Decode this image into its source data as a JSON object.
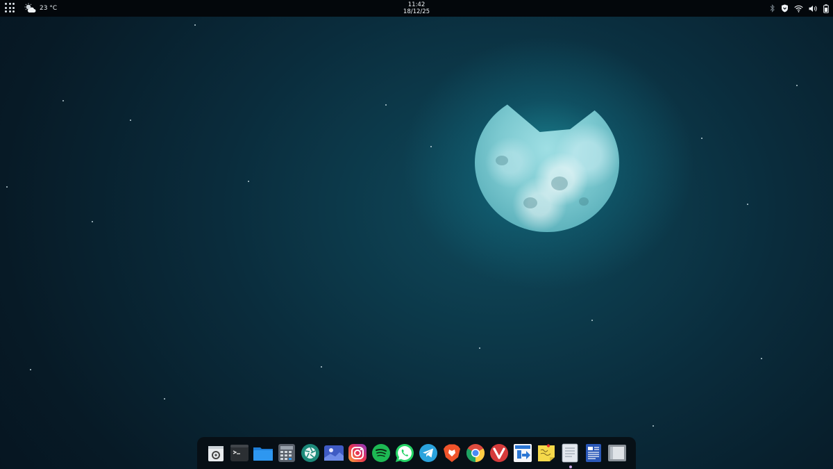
{
  "topbar": {
    "weather": {
      "temperature": "23 °C",
      "icon": "cloudy-sun-icon"
    },
    "clock": {
      "time": "11:42",
      "date": "18/12/25"
    },
    "tray_icons": [
      "bluetooth-icon",
      "vpn-shield-icon",
      "wifi-icon",
      "volume-icon",
      "battery-icon"
    ]
  },
  "dock": {
    "items": [
      {
        "name": "store-app",
        "icon": "software-store-icon"
      },
      {
        "name": "terminal-app",
        "icon": "terminal-icon"
      },
      {
        "name": "files-app",
        "icon": "folder-icon"
      },
      {
        "name": "calculator-app",
        "icon": "calculator-icon"
      },
      {
        "name": "camera-app",
        "icon": "camera-aperture-icon"
      },
      {
        "name": "photos-app",
        "icon": "image-viewer-icon"
      },
      {
        "name": "instagram-app",
        "icon": "instagram-icon"
      },
      {
        "name": "spotify-app",
        "icon": "spotify-icon"
      },
      {
        "name": "whatsapp-app",
        "icon": "whatsapp-icon"
      },
      {
        "name": "telegram-app",
        "icon": "telegram-icon"
      },
      {
        "name": "brave-app",
        "icon": "brave-lion-icon"
      },
      {
        "name": "chrome-app",
        "icon": "chrome-icon"
      },
      {
        "name": "vivaldi-app",
        "icon": "vivaldi-icon"
      },
      {
        "name": "anydesk-app",
        "icon": "remote-desktop-icon"
      },
      {
        "name": "notes-app",
        "icon": "sticky-notes-icon"
      },
      {
        "name": "document-viewer-app",
        "icon": "document-icon"
      },
      {
        "name": "writer-app",
        "icon": "word-processor-icon"
      },
      {
        "name": "window-app",
        "icon": "window-manager-icon"
      }
    ],
    "running_indicator": "dot-under-notes"
  },
  "colors": {
    "topbar_bg": "#03070b",
    "dock_bg": "#080e14",
    "wallpaper_dark": "#071a26",
    "moon_glow": "#28bec8"
  }
}
